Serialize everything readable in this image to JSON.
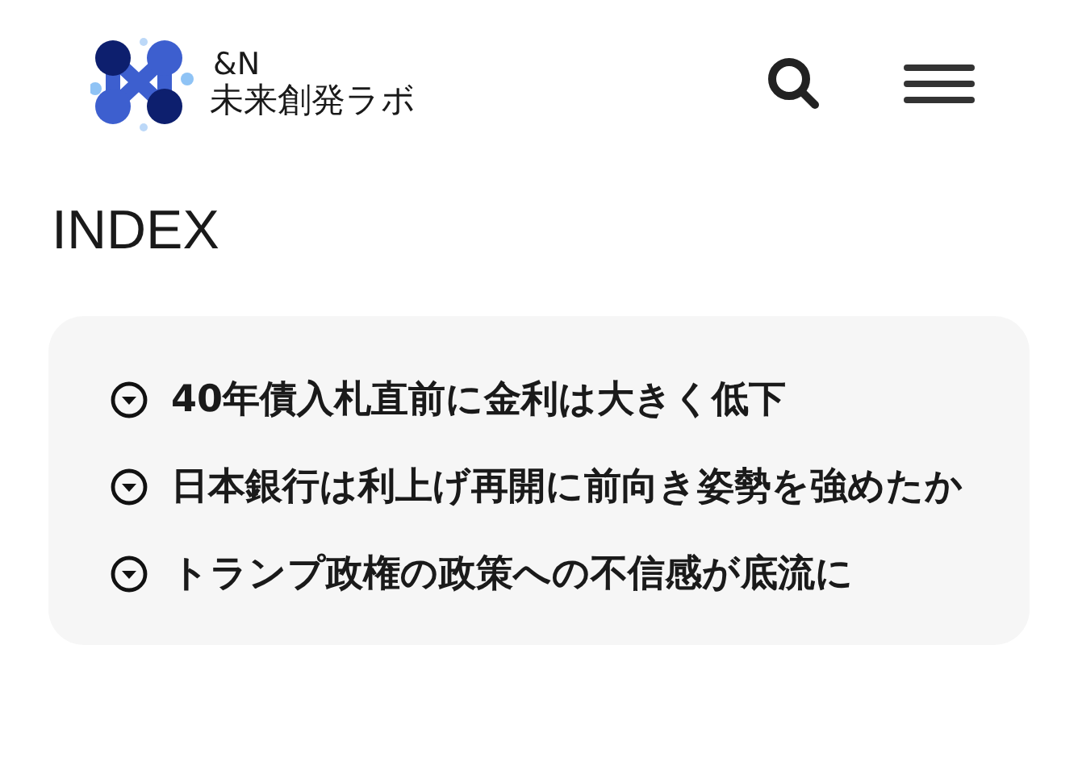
{
  "header": {
    "logo_line_1": "&N",
    "logo_line_2": "未来創発ラボ"
  },
  "index": {
    "title": "INDEX",
    "items": [
      {
        "text": "40年債入札直前に金利は大きく低下"
      },
      {
        "text": "日本銀行は利上げ再開に前向き姿勢を強めたか"
      },
      {
        "text": "トランプ政権の政策への不信感が底流に"
      }
    ]
  }
}
